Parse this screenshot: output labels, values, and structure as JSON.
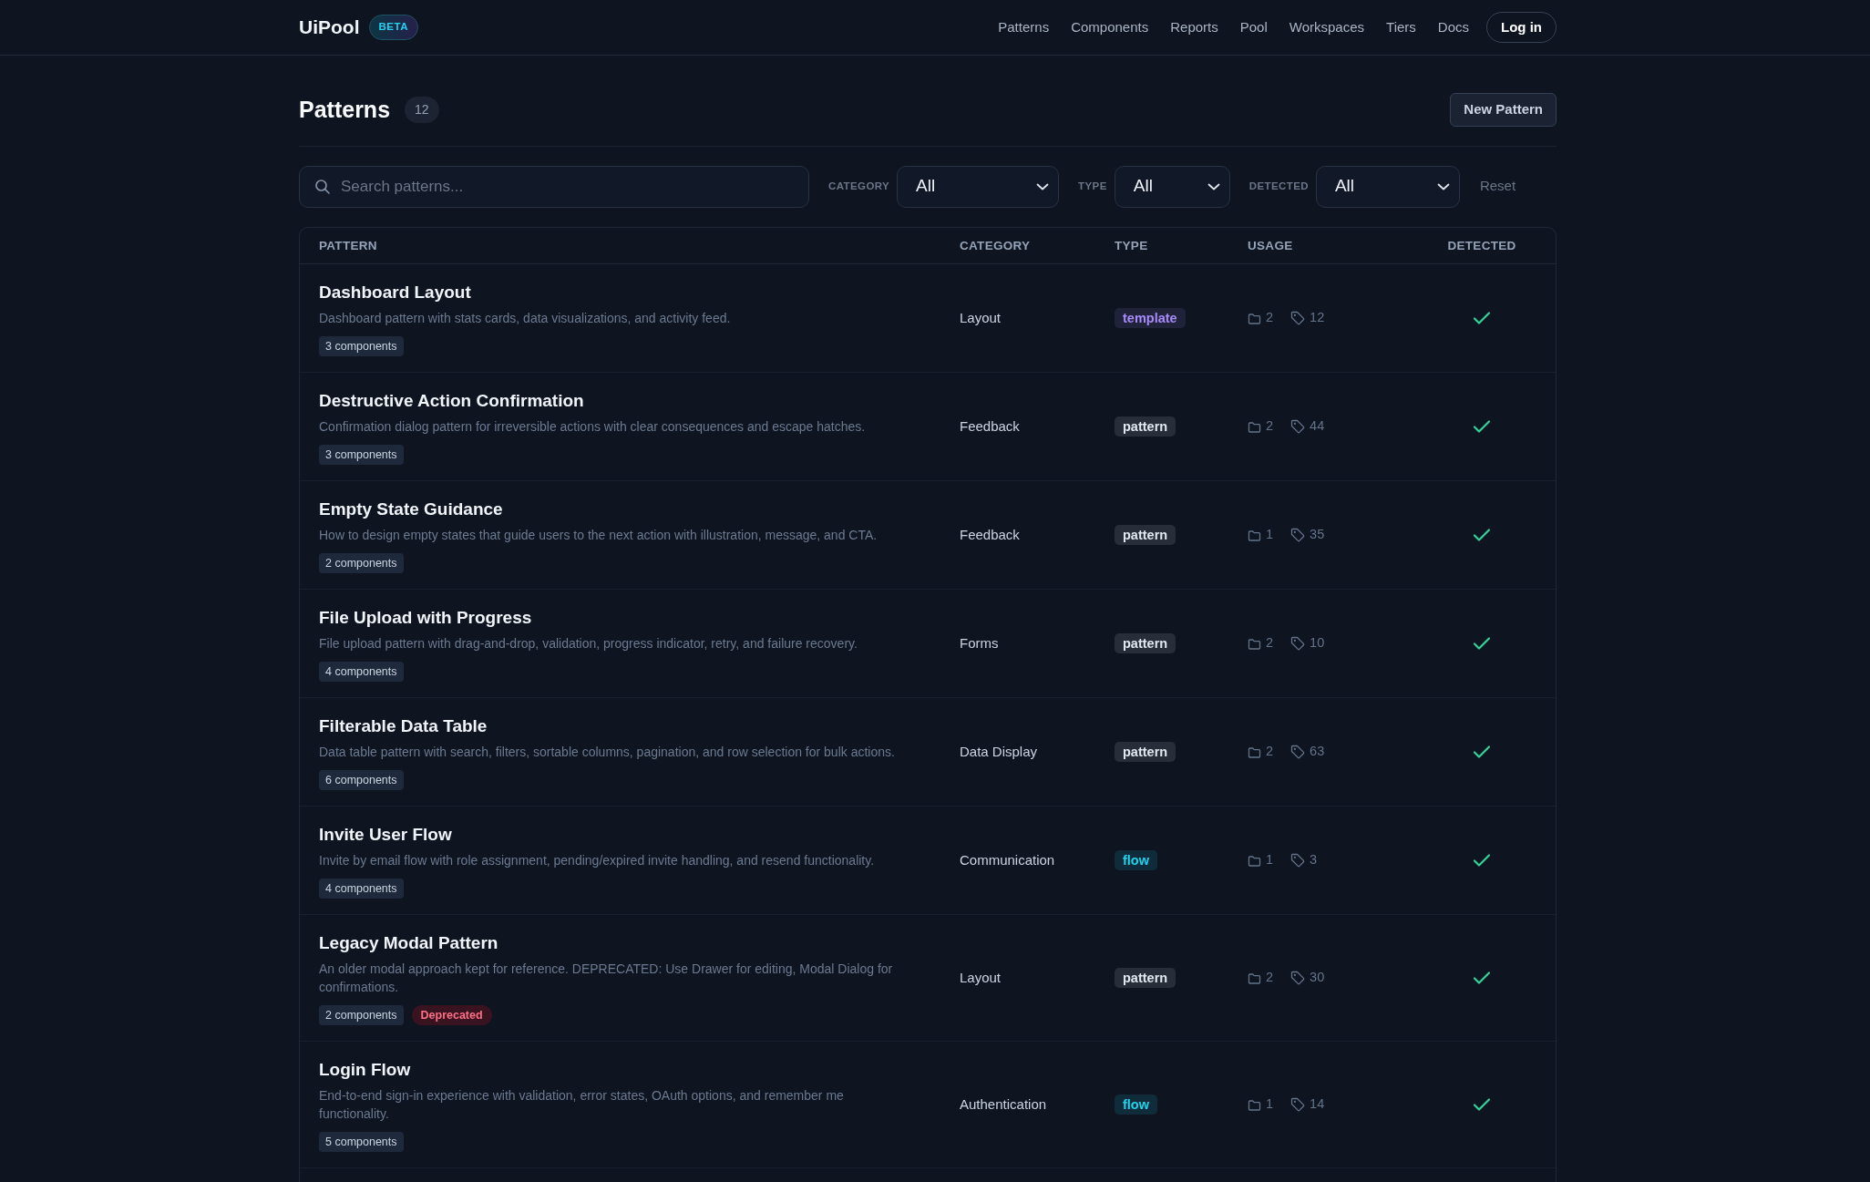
{
  "navbar": {
    "brand": "UiPool",
    "badge": "BETA",
    "links": [
      "Patterns",
      "Components",
      "Reports",
      "Pool",
      "Workspaces",
      "Tiers",
      "Docs"
    ],
    "login_button": "Log in"
  },
  "header": {
    "title": "Patterns",
    "count": "12",
    "new_button": "New Pattern"
  },
  "filters": {
    "search": {
      "placeholder": "Search patterns..."
    },
    "selects": [
      {
        "label": "CATEGORY",
        "value": "All"
      },
      {
        "label": "TYPE",
        "value": "All"
      },
      {
        "label": "DETECTED",
        "value": "All"
      }
    ],
    "reset": "Reset"
  },
  "table": {
    "columns": [
      "PATTERN",
      "CATEGORY",
      "TYPE",
      "USAGE",
      "DETECTED"
    ],
    "rows": [
      {
        "title": "Dashboard Layout",
        "description": "Dashboard pattern with stats cards, data visualizations, and activity feed.",
        "badges": [
          {
            "kind": "count",
            "label": "3 components"
          }
        ],
        "category": "Layout",
        "type": {
          "label": "template",
          "color": "#a78bfa"
        },
        "folder_count": "2",
        "tag_count": "12",
        "detected": true
      },
      {
        "title": "Destructive Action Confirmation",
        "description": "Confirmation dialog pattern for irreversible actions with clear consequences and escape hatches.",
        "badges": [
          {
            "kind": "count",
            "label": "3 components"
          }
        ],
        "category": "Feedback",
        "type": {
          "label": "pattern",
          "color": "#e2e8f0"
        },
        "folder_count": "2",
        "tag_count": "44",
        "detected": true
      },
      {
        "title": "Empty State Guidance",
        "description": "How to design empty states that guide users to the next action with illustration, message, and CTA.",
        "badges": [
          {
            "kind": "count",
            "label": "2 components"
          }
        ],
        "category": "Feedback",
        "type": {
          "label": "pattern",
          "color": "#e2e8f0"
        },
        "folder_count": "1",
        "tag_count": "35",
        "detected": true
      },
      {
        "title": "File Upload with Progress",
        "description": "File upload pattern with drag-and-drop, validation, progress indicator, retry, and failure recovery.",
        "badges": [
          {
            "kind": "count",
            "label": "4 components"
          }
        ],
        "category": "Forms",
        "type": {
          "label": "pattern",
          "color": "#e2e8f0"
        },
        "folder_count": "2",
        "tag_count": "10",
        "detected": true
      },
      {
        "title": "Filterable Data Table",
        "description": "Data table pattern with search, filters, sortable columns, pagination, and row selection for bulk actions.",
        "badges": [
          {
            "kind": "count",
            "label": "6 components"
          }
        ],
        "category": "Data Display",
        "type": {
          "label": "pattern",
          "color": "#e2e8f0"
        },
        "folder_count": "2",
        "tag_count": "63",
        "detected": true
      },
      {
        "title": "Invite User Flow",
        "description": "Invite by email flow with role assignment, pending/expired invite handling, and resend functionality.",
        "badges": [
          {
            "kind": "count",
            "label": "4 components"
          }
        ],
        "category": "Communication",
        "type": {
          "label": "flow",
          "color": "#22d3ee"
        },
        "folder_count": "1",
        "tag_count": "3",
        "detected": true
      },
      {
        "title": "Legacy Modal Pattern",
        "description": "An older modal approach kept for reference. DEPRECATED: Use Drawer for editing, Modal Dialog for confirmations.",
        "badges": [
          {
            "kind": "count",
            "label": "2 components"
          },
          {
            "kind": "deprecated",
            "label": "Deprecated"
          }
        ],
        "category": "Layout",
        "type": {
          "label": "pattern",
          "color": "#e2e8f0"
        },
        "folder_count": "2",
        "tag_count": "30",
        "detected": true
      },
      {
        "title": "Login Flow",
        "description": "End-to-end sign-in experience with validation, error states, OAuth options, and remember me functionality.",
        "badges": [
          {
            "kind": "count",
            "label": "5 components"
          }
        ],
        "category": "Authentication",
        "type": {
          "label": "flow",
          "color": "#22d3ee"
        },
        "folder_count": "1",
        "tag_count": "14",
        "detected": true
      }
    ]
  }
}
